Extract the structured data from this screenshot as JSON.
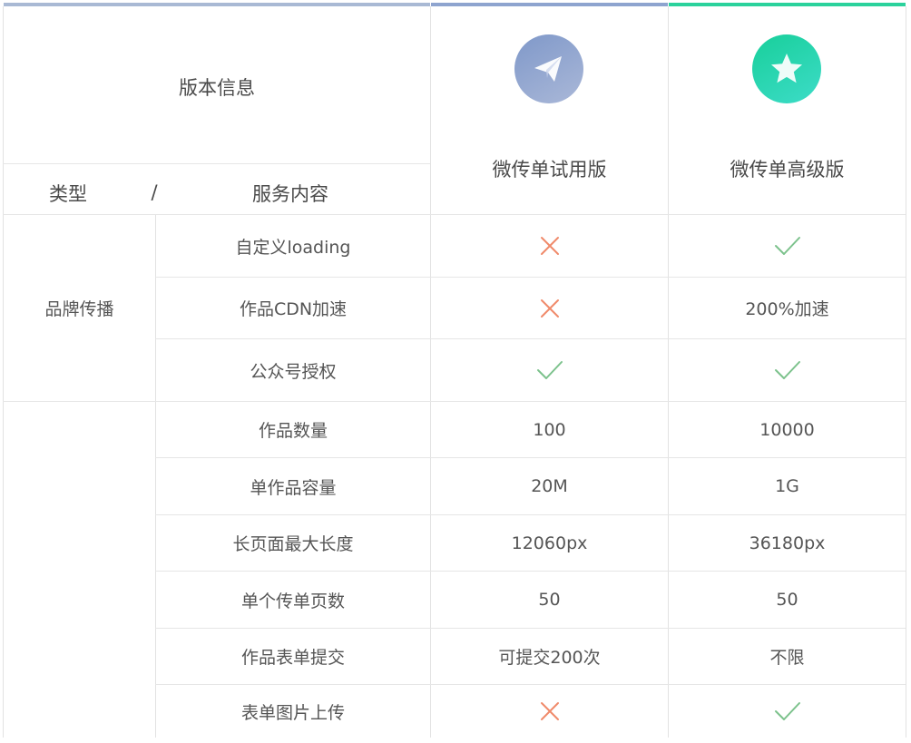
{
  "header": {
    "version_info": "版本信息",
    "type_label": "类型",
    "slash": "/",
    "service_label": "服务内容",
    "plans": [
      {
        "name": "微传单试用版",
        "icon": "paper-plane-icon",
        "color": "#8ea4cf"
      },
      {
        "name": "微传单高级版",
        "icon": "star-icon",
        "color": "#2fd6b0"
      }
    ]
  },
  "groups": [
    {
      "name": "品牌传播"
    },
    {
      "name": ""
    }
  ],
  "rows": [
    {
      "label": "自定义loading",
      "trial": {
        "kind": "cross"
      },
      "premium": {
        "kind": "check"
      }
    },
    {
      "label": "作品CDN加速",
      "trial": {
        "kind": "cross"
      },
      "premium": {
        "kind": "text",
        "text": "200%加速"
      }
    },
    {
      "label": "公众号授权",
      "trial": {
        "kind": "check"
      },
      "premium": {
        "kind": "check"
      }
    },
    {
      "label": "作品数量",
      "trial": {
        "kind": "text",
        "text": "100"
      },
      "premium": {
        "kind": "text",
        "text": "10000"
      }
    },
    {
      "label": "单作品容量",
      "trial": {
        "kind": "text",
        "text": "20M"
      },
      "premium": {
        "kind": "text",
        "text": "1G"
      }
    },
    {
      "label": "长页面最大长度",
      "trial": {
        "kind": "text",
        "text": "12060px"
      },
      "premium": {
        "kind": "text",
        "text": "36180px"
      }
    },
    {
      "label": "单个传单页数",
      "trial": {
        "kind": "text",
        "text": "50"
      },
      "premium": {
        "kind": "text",
        "text": "50"
      }
    },
    {
      "label": "作品表单提交",
      "trial": {
        "kind": "text",
        "text": "可提交200次"
      },
      "premium": {
        "kind": "text",
        "text": "不限"
      }
    },
    {
      "label": "表单图片上传",
      "trial": {
        "kind": "cross"
      },
      "premium": {
        "kind": "check"
      }
    }
  ],
  "colors": {
    "bar_left": "#a9b9d4",
    "bar_trial": "#8ea4cf",
    "bar_premium": "#2bd29c",
    "cross": "#f08a6a",
    "check": "#7cc28c"
  }
}
